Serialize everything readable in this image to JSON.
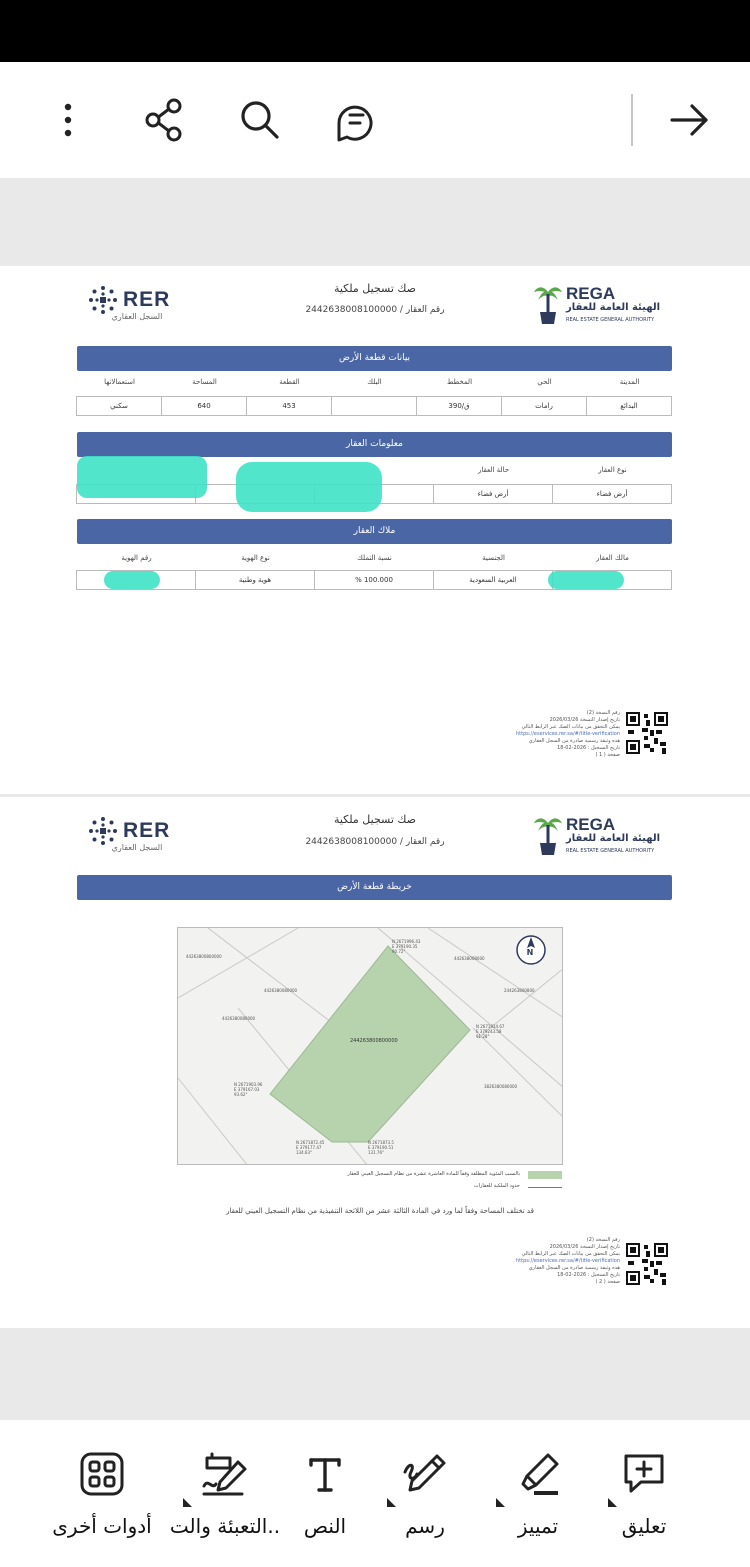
{
  "toolbar": {
    "icons": [
      "more-vertical-icon",
      "share-icon",
      "search-icon",
      "comments-icon",
      "arrow-right-icon"
    ]
  },
  "document": {
    "title": "صك تسجيل ملكية",
    "property_number": "رقم العقار / 2442638008100000",
    "rer_logo": {
      "text": "RER",
      "subtitle": "السجل العقاري"
    },
    "rega_logo": {
      "text": "REGA",
      "arabic": "الهيئة العامة للعقار",
      "english": "REAL ESTATE GENERAL AUTHORITY"
    },
    "page1": {
      "land_section": {
        "title": "بيانات قطعة الأرض",
        "labels": [
          "المدينة",
          "الحي",
          "المخطط",
          "البلك",
          "القطعة",
          "المساحة",
          "استعمالاتها"
        ],
        "values": [
          "البدائع",
          "رامات",
          "390/ق",
          "",
          "453",
          "640",
          "سكني"
        ]
      },
      "property_section": {
        "title": "معلومات العقار",
        "labels": [
          "نوع العقار",
          "حالة العقار",
          "",
          "",
          ""
        ],
        "values": [
          "أرض فضاء",
          "أرض فضاء",
          "",
          "",
          ""
        ]
      },
      "owners_section": {
        "title": "ملاك العقار",
        "labels": [
          "مالك العقار",
          "الجنسية",
          "نسبة التملك",
          "نوع الهوية",
          "رقم الهوية"
        ],
        "values": [
          "",
          "العربية السعودية",
          "% 100.000",
          "هوية وطنية",
          ""
        ]
      },
      "footer": {
        "version": "رقم النسخة (2)",
        "issue_date": "تاريخ إصدار النسخة 2026/03/26",
        "verify_text": "يمكن التحقق من بيانات الصك عبر الرابط التالي",
        "link": "https://eservices.rer.sa/#/title-verification",
        "official_note": "هذه وثيقة رسمية صادرة من السجل العقاري",
        "registration_date": "تاريخ التسجيل : 2026-02-18",
        "page_label": "صفحة ( 1 )"
      }
    },
    "page2": {
      "map_section": {
        "title": "خريطة قطعة الأرض"
      },
      "map": {
        "parcel_id": "244263800800000",
        "corners": [
          {
            "n": "N 2671996.43",
            "e": "E 379190.35",
            "angle": "90.72°"
          },
          {
            "n": "N 2671914.67",
            "e": "E 379243.58",
            "angle": "91.28°"
          },
          {
            "n": "N 2671873.5",
            "e": "E 379190.51",
            "angle": "131.76°"
          },
          {
            "n": "N 2671872.45",
            "e": "E 379177.47",
            "angle": "134.63°"
          },
          {
            "n": "N 2671903.96",
            "e": "E 379167.03",
            "angle": "93.62°"
          }
        ],
        "neighbors": [
          "44263800800000",
          "4426380080000",
          "442638008000",
          "244263800800",
          "3826380080000",
          "4426380080000"
        ],
        "north_label": "N"
      },
      "legend": {
        "item1": "بالنسب المئوية المطلقة وفقاً للمادة العاشرة عشرة من نظام التسجيل العيني للعقار",
        "item2": "حدود الملكية للعقارات"
      },
      "note": "قد تختلف المساحة وفقاً لما ورد في المادة الثالثة عشر من اللائحة التنفيذية من نظام التسجيل العيني للعقار",
      "footer": {
        "version": "رقم النسخة (2)",
        "issue_date": "تاريخ إصدار النسخة 2026/03/26",
        "verify_text": "يمكن التحقق من بيانات الصك عبر الرابط التالي",
        "link": "https://eservices.rer.sa/#/title-verification",
        "official_note": "هذه وثيقة رسمية صادرة من السجل العقاري",
        "registration_date": "تاريخ التسجيل : 2026-02-18",
        "page_label": "صفحة ( 2 )"
      }
    }
  },
  "bottom_toolbar": {
    "items": [
      {
        "label": "تعليق",
        "icon": "comment-add-icon"
      },
      {
        "label": "تمييز",
        "icon": "highlighter-icon"
      },
      {
        "label": "رسم",
        "icon": "pen-draw-icon"
      },
      {
        "label": "النص",
        "icon": "text-icon"
      },
      {
        "label": "التعبئة والت..",
        "icon": "fill-sign-icon"
      },
      {
        "label": "أدوات أخرى",
        "icon": "more-tools-icon"
      }
    ]
  },
  "colors": {
    "section_header": "#4b66a5",
    "redaction": "#3ee3c6",
    "parcel_fill": "#b7d3ae",
    "logo_navy": "#2d3a5c",
    "logo_green": "#5aa84a"
  }
}
